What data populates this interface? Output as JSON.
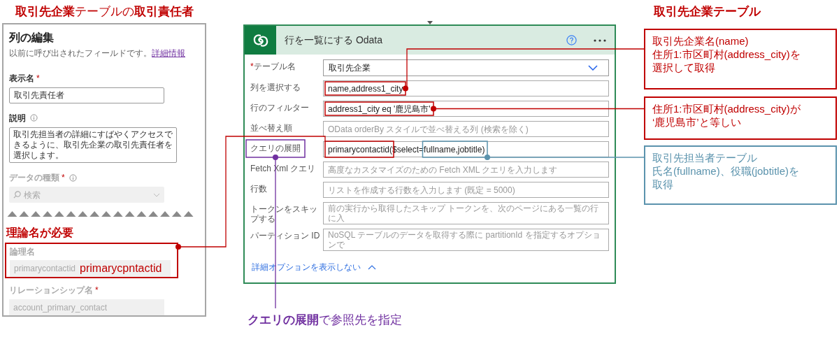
{
  "left_title": "**取引先企業**テーブルの**取引責任者**",
  "right_title": "取引先企業テーブル",
  "column_editor": {
    "title": "列の編集",
    "subtitle": "以前に呼び出されたフィールドです。",
    "link": "詳細情報",
    "fields": [
      {
        "kind": "text",
        "label": "表示名",
        "required_mark": "*",
        "info": false,
        "disabled": false,
        "value": "取引先責任者"
      },
      {
        "kind": "textarea",
        "label": "説明",
        "info": true,
        "disabled": false,
        "value": "取引先担当者の詳細にすばやくアクセスできるように、取引先企業の取引先責任者を選択します。"
      },
      {
        "kind": "search",
        "label": "データの種類",
        "required_mark": "*",
        "info": true,
        "disabled": true,
        "placeholder": "検索"
      }
    ],
    "note": "理論名が必要",
    "lower_fields": [
      {
        "label": "論理名",
        "disabled": true,
        "value": "primarycontactid",
        "callout": "primarycpntactid"
      },
      {
        "label": "リレーションシップ名",
        "required_mark": "*",
        "disabled": true,
        "value": "account_primary_contact"
      }
    ]
  },
  "odata_card": {
    "title": "行を一覧にする Odata",
    "rows": [
      {
        "kind": "dropdown",
        "label": "テーブル名",
        "required_mark": "*",
        "value": "取引先企業"
      },
      {
        "kind": "text",
        "label": "列を選択する",
        "value": "name,address1_city"
      },
      {
        "kind": "text",
        "label": "行のフィルター",
        "value": "address1_city eq '鹿児島市'"
      },
      {
        "kind": "text",
        "label": "並べ替え順",
        "placeholder": "OData orderBy スタイルで並べ替える列 (検索を除く)"
      },
      {
        "kind": "text",
        "label": "クエリの展開",
        "value": "primarycontactid($select=fullname,jobtitle)"
      },
      {
        "kind": "text",
        "label": "Fetch Xml クエリ",
        "placeholder": "高度なカスタマイズのための Fetch XML クエリを入力します"
      },
      {
        "kind": "text",
        "label": "行数",
        "placeholder": "リストを作成する行数を入力します (既定 = 5000)"
      },
      {
        "kind": "text",
        "label": "トークンをスキップする",
        "placeholder": "前の実行から取得したスキップ トークンを、次のページにある一覧の行に入"
      },
      {
        "kind": "text",
        "label": "パーティション ID",
        "placeholder": "NoSQL テーブルのデータを取得する際に partitionId を指定するオプションで"
      }
    ],
    "options_link": "詳細オプションを表示しない"
  },
  "annotations": [
    {
      "lines": [
        "取引先企業名(name)",
        "住所1:市区町村(address_city)を",
        "選択して取得"
      ],
      "color": "#c00000"
    },
    {
      "lines": [
        "住所1:市区町村(address_city)が",
        "‘鹿児島市’と等しい"
      ],
      "color": "#c00000"
    },
    {
      "lines": [
        "取引先担当者テーブル",
        "氏名(fullname)、役職(jobtitle)を",
        "取得"
      ],
      "color": "#5b93ad"
    }
  ],
  "caption": "**クエリの展開**で参照先を指定"
}
